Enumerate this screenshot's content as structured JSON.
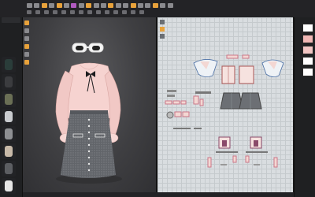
{
  "colors": {
    "accent_orange": "#e8a23b",
    "pattern_bg": "#d9dde0",
    "garment_pink": "#f2c6c4",
    "skirt_gray": "#6c6f74"
  },
  "toolbar": {
    "icons": [
      "select-icon",
      "move-icon",
      "rotate-icon",
      "scale-icon",
      "pin-icon",
      "brush-icon",
      "needle-icon",
      "tape-icon",
      "cut-icon",
      "seam-icon",
      "fold-icon",
      "flip-icon",
      "measure-icon",
      "texture-icon",
      "button-icon",
      "zipper-icon",
      "trim-icon",
      "avatar-icon",
      "camera-icon",
      "render-icon"
    ]
  },
  "library": {
    "items": [
      "garment-thumbnail",
      "jacket-thumbnail",
      "dress-thumbnail",
      "avatar-thumbnail",
      "shirt-thumbnail",
      "coat-thumbnail",
      "pants-thumbnail",
      "top-thumbnail"
    ]
  },
  "viewport": {
    "tools": [
      "simulate-icon",
      "select-mesh-icon",
      "transform-icon",
      "pin-tool-icon",
      "tack-icon",
      "avatar-measure-icon"
    ]
  },
  "pattern_window": {
    "tools": [
      "edit-pattern-icon",
      "transform-pattern-icon",
      "seam-line-icon"
    ]
  },
  "right_panel": {
    "swatches": [
      "#ffffff",
      "#f0b7b5",
      "#f2c6c4",
      "#ffffff",
      "#ffffff"
    ]
  }
}
